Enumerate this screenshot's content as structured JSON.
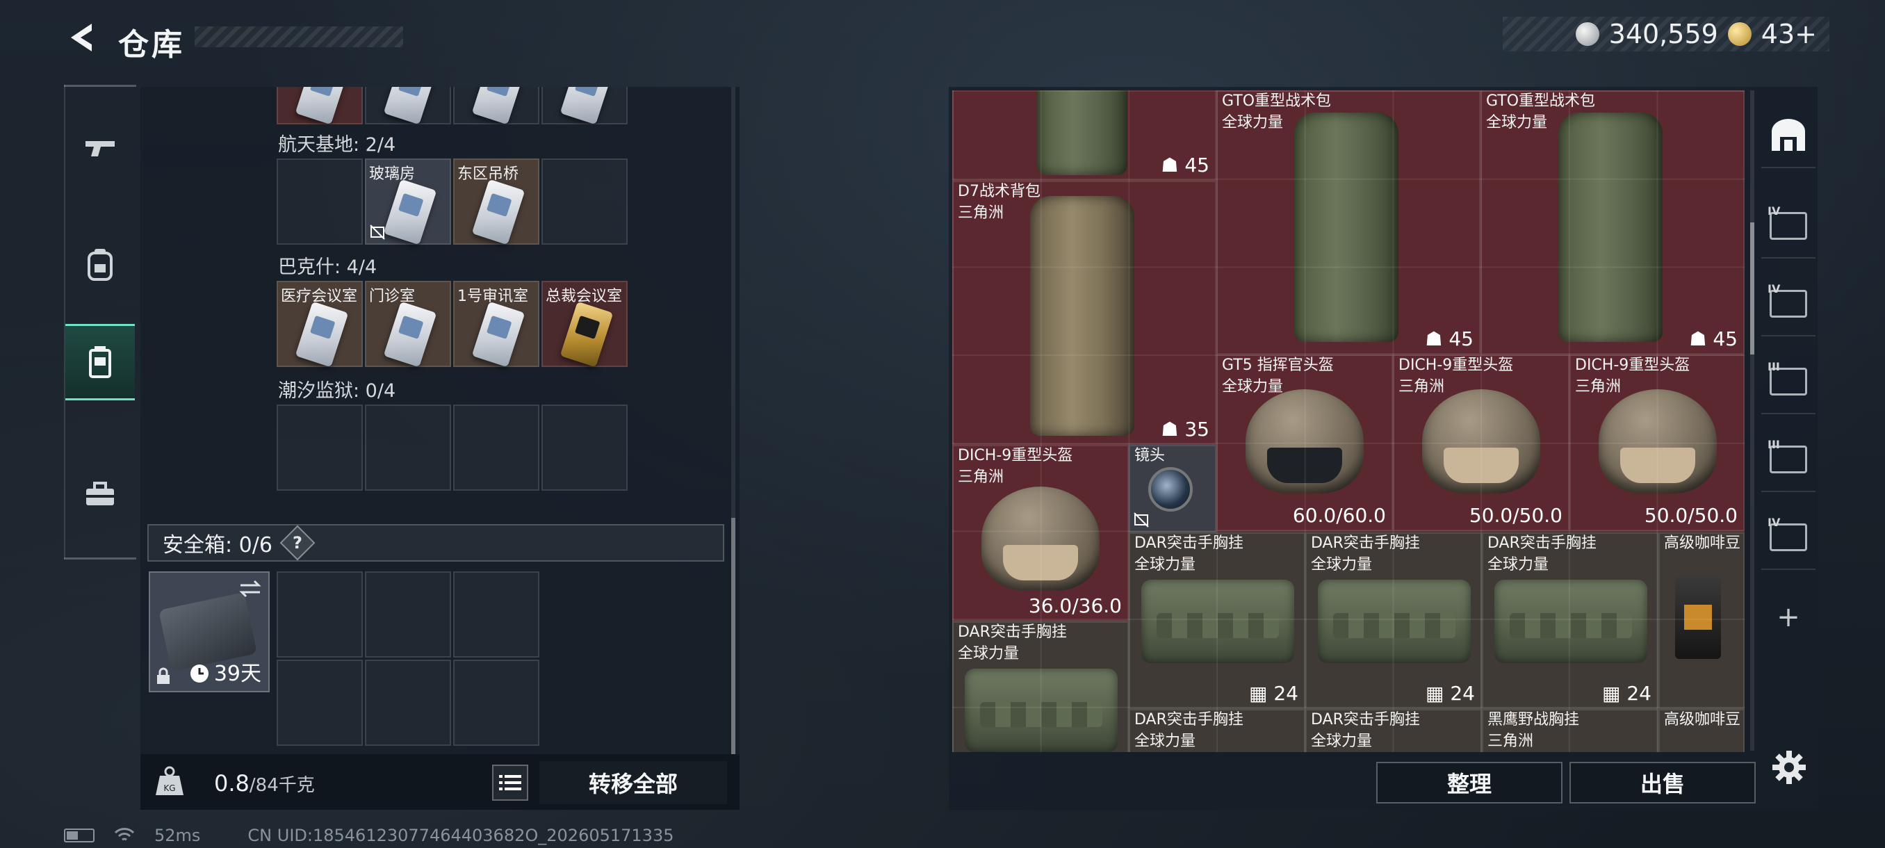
{
  "header": {
    "title": "仓库"
  },
  "currency": {
    "silver": "340,559",
    "gold": "43+"
  },
  "left_rail": {
    "tabs": [
      {
        "name": "weapons",
        "icon": "gun-icon"
      },
      {
        "name": "equipment",
        "icon": "backpack-icon"
      },
      {
        "name": "keys",
        "icon": "keycard-case-icon",
        "active": true
      },
      {
        "name": "misc",
        "icon": "toolbox-icon"
      }
    ]
  },
  "key_sections": [
    {
      "label": "航天基地: 2/4",
      "slots": [
        {
          "name": ""
        },
        {
          "name": "玻璃房",
          "color": "gray",
          "card": "white",
          "noshare": true
        },
        {
          "name": "东区吊桥",
          "color": "brown",
          "card": "white"
        },
        {
          "name": ""
        }
      ]
    },
    {
      "label": "巴克什: 4/4",
      "slots": [
        {
          "name": "医疗会议室",
          "color": "brown",
          "card": "white"
        },
        {
          "name": "门诊室",
          "color": "brown",
          "card": "white"
        },
        {
          "name": "1号审讯室",
          "color": "brown",
          "card": "white"
        },
        {
          "name": "总裁会议室",
          "color": "red",
          "card": "gold"
        }
      ]
    },
    {
      "label": "潮汐监狱: 0/4",
      "slots": [
        {
          "name": ""
        },
        {
          "name": ""
        },
        {
          "name": ""
        },
        {
          "name": ""
        }
      ]
    }
  ],
  "safe_box": {
    "label": "安全箱: 0/6",
    "help": "?",
    "days": "39天"
  },
  "weight": {
    "current": "0.8",
    "max": "/84千克"
  },
  "buttons": {
    "transfer_all": "转移全部",
    "sort": "整理",
    "sell": "出售"
  },
  "stash_items": [
    {
      "id": "top-backpack",
      "stat": "45"
    },
    {
      "id": "gto1",
      "name": "GTO重型战术包",
      "sub": "全球力量",
      "stat": "45"
    },
    {
      "id": "gto2",
      "name": "GTO重型战术包",
      "sub": "全球力量",
      "stat": "45"
    },
    {
      "id": "d7",
      "name": "D7战术背包",
      "sub": "三角洲",
      "stat": "35"
    },
    {
      "id": "gt5",
      "name": "GT5 指挥官头盔",
      "sub": "全球力量",
      "stat": "60.0/60.0"
    },
    {
      "id": "dich1",
      "name": "DICH-9重型头盔",
      "sub": "三角洲",
      "stat": "50.0/50.0"
    },
    {
      "id": "dich2",
      "name": "DICH-9重型头盔",
      "sub": "三角洲",
      "stat": "50.0/50.0"
    },
    {
      "id": "dich3",
      "name": "DICH-9重型头盔",
      "sub": "三角洲",
      "stat": "36.0/36.0"
    },
    {
      "id": "lens",
      "name": "镜头",
      "sub": ""
    },
    {
      "id": "dar1",
      "name": "DAR突击手胸挂",
      "sub": "全球力量",
      "stat": "24"
    },
    {
      "id": "dar2",
      "name": "DAR突击手胸挂",
      "sub": "全球力量",
      "stat": "24"
    },
    {
      "id": "dar3",
      "name": "DAR突击手胸挂",
      "sub": "全球力量",
      "stat": "24"
    },
    {
      "id": "coffee1",
      "name": "高级咖啡豆",
      "sub": ""
    },
    {
      "id": "dar4",
      "name": "DAR突击手胸挂",
      "sub": "全球力量"
    },
    {
      "id": "dar5",
      "name": "DAR突击手胸挂",
      "sub": "全球力量"
    },
    {
      "id": "dar6",
      "name": "DAR突击手胸挂",
      "sub": "全球力量"
    },
    {
      "id": "eagle",
      "name": "黑鹰野战胸挂",
      "sub": "三角洲"
    },
    {
      "id": "coffee2",
      "name": "高级咖啡豆",
      "sub": ""
    }
  ],
  "right_rail": [
    {
      "icon": "headquarters-icon",
      "tag": ""
    },
    {
      "icon": "case-icon",
      "tag": "IV"
    },
    {
      "icon": "case-icon",
      "tag": "IV"
    },
    {
      "icon": "case-icon",
      "tag": "III"
    },
    {
      "icon": "case-icon",
      "tag": "III"
    },
    {
      "icon": "case-icon",
      "tag": "IV"
    },
    {
      "icon": "plus-icon",
      "tag": "+"
    }
  ],
  "status": {
    "ping": "52ms",
    "uid": "CN UID:18546123077464403682O_202605171335"
  }
}
